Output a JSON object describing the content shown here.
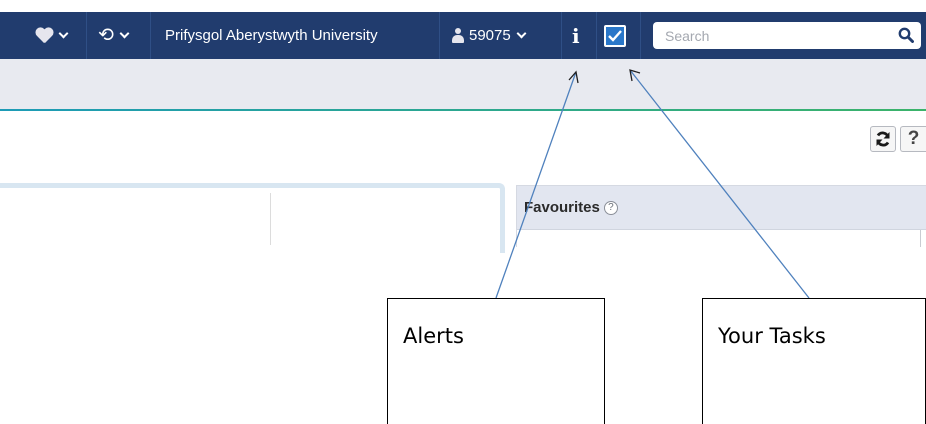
{
  "topbar": {
    "favourites_icon": "heart-icon",
    "history_icon": "history-icon",
    "institution": "Prifysgol Aberystwyth University",
    "user_id": "59075",
    "alerts_icon": "info-icon",
    "tasks_icon": "checkbox-icon",
    "search_placeholder": "Search"
  },
  "toolbar": {
    "refresh_icon": "refresh-icon",
    "help_label": "?"
  },
  "favourites": {
    "title": "Favourites",
    "help_label": "?"
  },
  "annotations": [
    {
      "label": "Alerts"
    },
    {
      "label": "Your Tasks"
    }
  ],
  "colors": {
    "topbar": "#213c6e",
    "subbar": "#e8eaf0",
    "tasks_accent": "#2a77c9"
  }
}
